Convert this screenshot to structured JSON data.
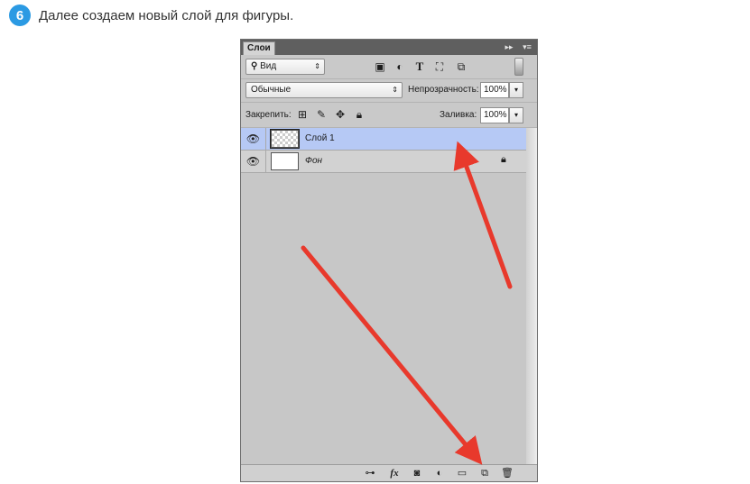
{
  "step": {
    "number": "6",
    "text": "Далее создаем новый слой для фигуры."
  },
  "panel": {
    "tab_label": "Слои",
    "collapse_icon": "double-arrow-icon",
    "menu_icon": "panel-menu-icon",
    "filter": {
      "label": "Вид",
      "filter_icons": [
        "image-filter-icon",
        "adjustment-filter-icon",
        "type-filter-icon",
        "shape-filter-icon",
        "smart-object-filter-icon"
      ]
    },
    "blend_mode": "Обычные",
    "opacity_label": "Непрозрачность:",
    "opacity_value": "100%",
    "lock_label": "Закрепить:",
    "fill_label": "Заливка:",
    "fill_value": "100%",
    "layers": [
      {
        "name": "Слой 1",
        "selected": true,
        "transparent_thumb": true,
        "locked": false
      },
      {
        "name": "Фон",
        "selected": false,
        "transparent_thumb": false,
        "locked": true
      }
    ],
    "bottom_icons": [
      "link-icon",
      "fx-icon",
      "mask-icon",
      "adjustment-icon",
      "folder-icon",
      "new-layer-icon",
      "trash-icon"
    ]
  },
  "colors": {
    "badge": "#2b9ae3",
    "selected_layer": "#b6c9f5",
    "annotation_arrow": "#e8392c"
  }
}
